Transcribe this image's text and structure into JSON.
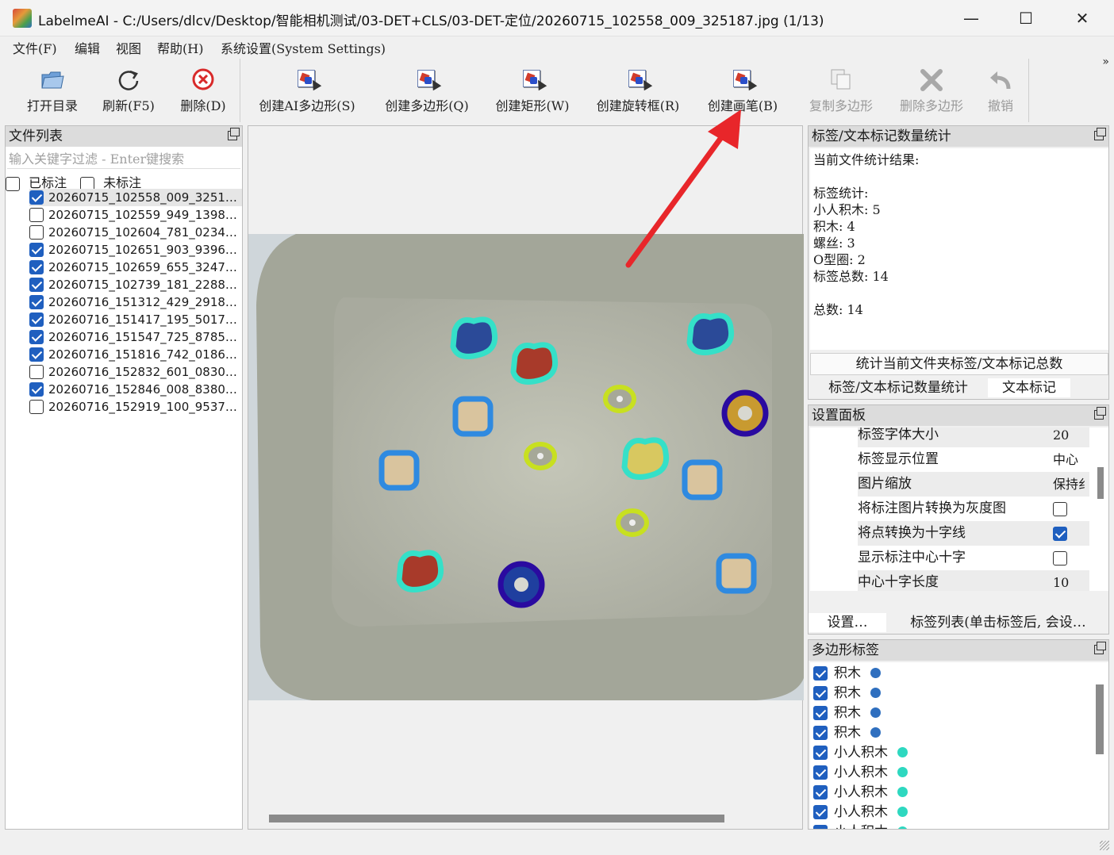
{
  "window": {
    "title": "LabelmeAI - C:/Users/dlcv/Desktop/智能相机测试/03-DET+CLS/03-DET-定位/20260715_102558_009_325187.jpg (1/13)",
    "minimize": "—",
    "maximize": "☐",
    "close": "✕"
  },
  "menu": [
    "文件(F)",
    "编辑",
    "视图",
    "帮助(H)",
    "系统设置(System Settings)"
  ],
  "toolbar": {
    "open_dir": "打开目录",
    "refresh": "刷新(F5)",
    "delete": "删除(D)",
    "create_ai_polygon": "创建AI多边形(S)",
    "create_polygon": "创建多边形(Q)",
    "create_rectangle": "创建矩形(W)",
    "create_rotated_box": "创建旋转框(R)",
    "create_brush": "创建画笔(B)",
    "copy_polygon": "复制多边形",
    "delete_polygon": "删除多边形",
    "undo": "撤销",
    "overflow": "»"
  },
  "file_list": {
    "title": "文件列表",
    "filter_placeholder": "输入关键字过滤 - Enter键搜索",
    "labeled": "已标注",
    "unlabeled": "未标注",
    "files": [
      {
        "name": "20260715_102558_009_3251…",
        "checked": true,
        "selected": true
      },
      {
        "name": "20260715_102559_949_1398…",
        "checked": false
      },
      {
        "name": "20260715_102604_781_0234…",
        "checked": false
      },
      {
        "name": "20260715_102651_903_9396…",
        "checked": true
      },
      {
        "name": "20260715_102659_655_3247…",
        "checked": true
      },
      {
        "name": "20260715_102739_181_2288…",
        "checked": true
      },
      {
        "name": "20260716_151312_429_2918…",
        "checked": true
      },
      {
        "name": "20260716_151417_195_5017…",
        "checked": true
      },
      {
        "name": "20260716_151547_725_8785…",
        "checked": true
      },
      {
        "name": "20260716_151816_742_0186…",
        "checked": true
      },
      {
        "name": "20260716_152832_601_0830…",
        "checked": false
      },
      {
        "name": "20260716_152846_008_8380…",
        "checked": true
      },
      {
        "name": "20260716_152919_100_9537…",
        "checked": false
      }
    ]
  },
  "stats": {
    "title": "标签/文本标记数量统计",
    "lines": [
      "当前文件统计结果:",
      "",
      "标签统计:",
      "小人积木: 5",
      "积木: 4",
      "螺丝: 3",
      "O型圈: 2",
      "标签总数: 14",
      "",
      "总数: 14"
    ],
    "button": "统计当前文件夹标签/文本标记总数",
    "tab_stats": "标签/文本标记数量统计",
    "tab_text": "文本标记"
  },
  "settings": {
    "title": "设置面板",
    "rows": [
      {
        "label": "标签字体大小",
        "value": "20"
      },
      {
        "label": "标签显示位置",
        "value": "中心"
      },
      {
        "label": "图片缩放",
        "value": "保持纟"
      },
      {
        "label": "将标注图片转换为灰度图",
        "checked": false
      },
      {
        "label": "将点转换为十字线",
        "checked": true
      },
      {
        "label": "显示标注中心十字",
        "checked": false
      },
      {
        "label": "中心十字长度",
        "value": "10"
      }
    ],
    "tab_settings": "设置…",
    "tab_labels": "标签列表(单击标签后, 会设…"
  },
  "polygons": {
    "title": "多边形标签",
    "items": [
      {
        "label": "积木",
        "color": "#2f6fbf"
      },
      {
        "label": "积木",
        "color": "#2f6fbf"
      },
      {
        "label": "积木",
        "color": "#2f6fbf"
      },
      {
        "label": "积木",
        "color": "#2f6fbf"
      },
      {
        "label": "小人积木",
        "color": "#2ed8c0"
      },
      {
        "label": "小人积木",
        "color": "#2ed8c0"
      },
      {
        "label": "小人积木",
        "color": "#2ed8c0"
      },
      {
        "label": "小人积木",
        "color": "#2ed8c0"
      },
      {
        "label": "小人积木",
        "color": "#2ed8c0"
      }
    ]
  },
  "colors": {
    "block": "#2f8ae0",
    "figure": "#35e0c8",
    "screw": "#c8e020",
    "oring": "#2a0aa0",
    "accent": "#1f5fbf",
    "arrow": "#e8262a"
  }
}
